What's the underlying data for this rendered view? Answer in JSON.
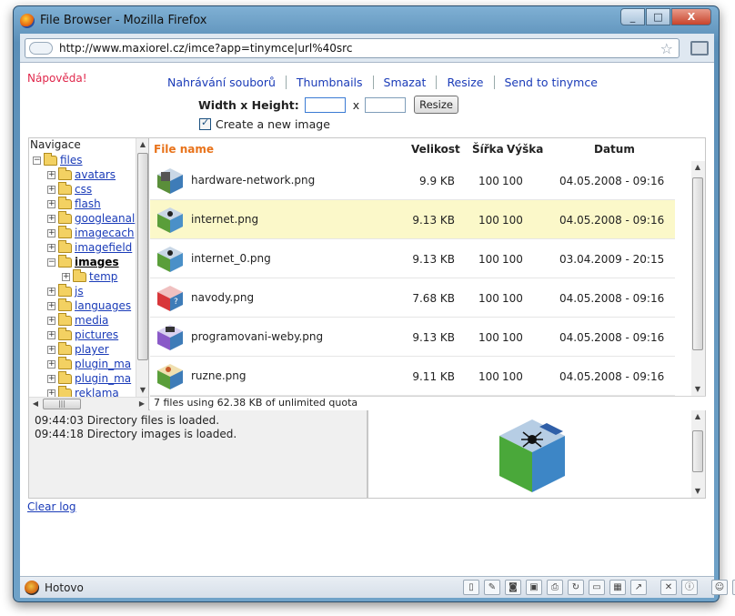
{
  "window": {
    "title": "File Browser - Mozilla Firefox",
    "buttons": [
      "_",
      "□",
      "X"
    ]
  },
  "urlbar": {
    "url": "http://www.maxiorel.cz/imce?app=tinymce|url%40src"
  },
  "help_link": "Nápověda!",
  "operations": [
    "Nahrávání souborů",
    "Thumbnails",
    "Smazat",
    "Resize",
    "Send to tinymce"
  ],
  "resize": {
    "label": "Width x Height:",
    "width_value": "",
    "height_value": "",
    "sep": "x",
    "button": "Resize"
  },
  "create_new_image": {
    "label": "Create a new image",
    "checked": true
  },
  "tree": {
    "header": "Navigace",
    "root": "files",
    "items": [
      {
        "label": "avatars"
      },
      {
        "label": "css"
      },
      {
        "label": "flash"
      },
      {
        "label": "googleanal"
      },
      {
        "label": "imagecach"
      },
      {
        "label": "imagefield"
      },
      {
        "label": "images"
      },
      {
        "label": "temp"
      },
      {
        "label": "js"
      },
      {
        "label": "languages"
      },
      {
        "label": "media"
      },
      {
        "label": "pictures"
      },
      {
        "label": "player"
      },
      {
        "label": "plugin_ma"
      },
      {
        "label": "plugin_ma"
      },
      {
        "label": "reklama"
      }
    ]
  },
  "files_header": {
    "name": "File name",
    "size": "Velikost",
    "width": "Šířka",
    "height": "Výška",
    "date": "Datum"
  },
  "files": [
    {
      "name": "hardware-network.png",
      "size": "9.9 KB",
      "width": "100",
      "height": "100",
      "date": "04.05.2008 - 09:16"
    },
    {
      "name": "internet.png",
      "size": "9.13 KB",
      "width": "100",
      "height": "100",
      "date": "04.05.2008 - 09:16"
    },
    {
      "name": "internet_0.png",
      "size": "9.13 KB",
      "width": "100",
      "height": "100",
      "date": "03.04.2009 - 20:15"
    },
    {
      "name": "navody.png",
      "size": "7.68 KB",
      "width": "100",
      "height": "100",
      "date": "04.05.2008 - 09:16"
    },
    {
      "name": "programovani-weby.png",
      "size": "9.13 KB",
      "width": "100",
      "height": "100",
      "date": "04.05.2008 - 09:16"
    },
    {
      "name": "ruzne.png",
      "size": "9.11 KB",
      "width": "100",
      "height": "100",
      "date": "04.05.2008 - 09:16"
    }
  ],
  "files_status": "7 files using 62.38 KB of unlimited quota",
  "log": [
    "09:44:03 Directory files is loaded.",
    "09:44:18 Directory images is loaded."
  ],
  "clear_log": "Clear log",
  "status": {
    "text": "Hotovo"
  }
}
